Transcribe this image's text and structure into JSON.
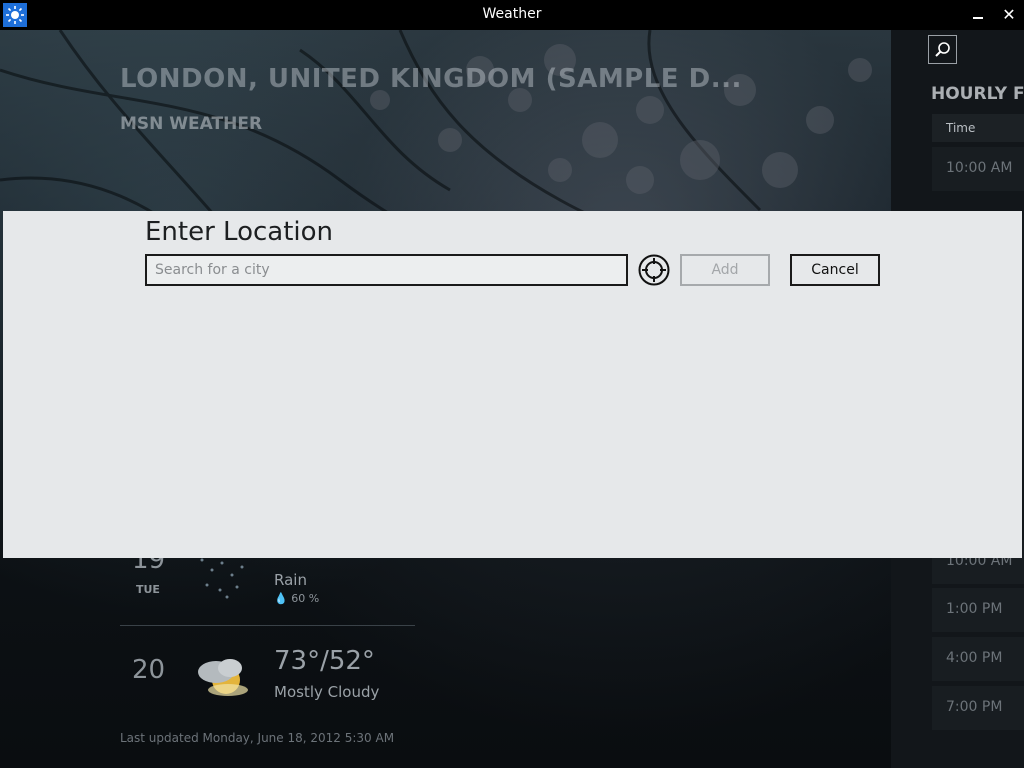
{
  "window": {
    "title": "Weather",
    "close_glyph": "✕"
  },
  "header": {
    "city": "LONDON, UNITED KINGDOM (SAMPLE D...",
    "provider": "MSN WEATHER"
  },
  "hourly": {
    "title": "HOURLY FO",
    "column_header": "Time",
    "rows": [
      "10:00 AM",
      "10:00 AM",
      "1:00 PM",
      "4:00 PM",
      "7:00 PM"
    ]
  },
  "forecast": [
    {
      "day": "19",
      "dow": "TUE",
      "condition": "Rain",
      "precip": "60 %"
    },
    {
      "day": "20",
      "temp": "73°/52°",
      "condition": "Mostly Cloudy"
    }
  ],
  "last_updated": "Last updated Monday, June 18, 2012 5:30 AM",
  "dialog": {
    "title": "Enter Location",
    "search_placeholder": "Search for a city",
    "search_value": "",
    "add_label": "Add",
    "cancel_label": "Cancel"
  },
  "colors": {
    "accent": "#1e6fd9",
    "dialog_bg": "#e6e8ea",
    "titlebar_bg": "#000000"
  },
  "icons": {
    "app": "sun-icon",
    "search": "search-icon",
    "locate": "crosshair-icon",
    "rain": "rain-icon",
    "cloudy": "partly-cloudy-icon"
  }
}
